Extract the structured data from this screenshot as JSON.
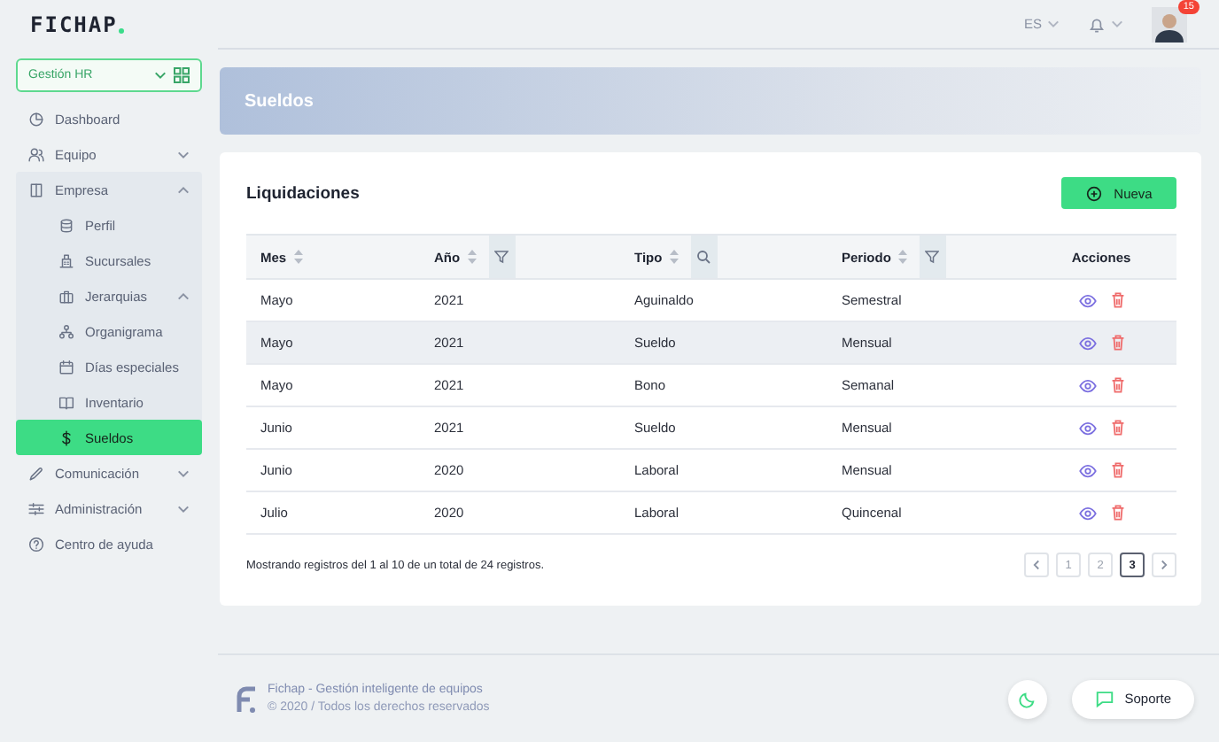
{
  "brand": {
    "logo": "FICHAP"
  },
  "sidebar": {
    "workspace": "Gestión HR",
    "items": [
      {
        "label": "Dashboard",
        "selected": false
      },
      {
        "label": "Equipo",
        "expanded": false,
        "selected": false
      },
      {
        "label": "Empresa",
        "expanded": true,
        "selected": false,
        "children": [
          {
            "label": "Perfil",
            "selected": false
          },
          {
            "label": "Sucursales",
            "selected": false
          },
          {
            "label": "Jerarquias",
            "expanded": true,
            "selected": false
          },
          {
            "label": "Organigrama",
            "selected": false
          },
          {
            "label": "Días especiales",
            "selected": false
          },
          {
            "label": "Inventario",
            "selected": false
          },
          {
            "label": "Sueldos",
            "selected": true
          }
        ]
      },
      {
        "label": "Comunicación",
        "expanded": false,
        "selected": false
      },
      {
        "label": "Administración",
        "expanded": false,
        "selected": false
      },
      {
        "label": "Centro de ayuda",
        "selected": false
      }
    ]
  },
  "header": {
    "language": "ES",
    "notifications_badge": "15"
  },
  "banner": {
    "title": "Sueldos"
  },
  "card": {
    "title": "Liquidaciones",
    "new_button": "Nueva",
    "table": {
      "columns": [
        {
          "label": "Mes",
          "sortable": true,
          "kind": "plain"
        },
        {
          "label": "Año",
          "sortable": true,
          "kind": "filter"
        },
        {
          "label": "Tipo",
          "sortable": true,
          "kind": "search"
        },
        {
          "label": "Periodo",
          "sortable": true,
          "kind": "filter"
        },
        {
          "label": "Acciones",
          "sortable": false,
          "kind": "plain"
        }
      ],
      "rows": [
        {
          "cells": [
            "Mayo",
            "2021",
            "Aguinaldo",
            "Semestral"
          ],
          "hovered": false
        },
        {
          "cells": [
            "Mayo",
            "2021",
            "Sueldo",
            "Mensual"
          ],
          "hovered": true
        },
        {
          "cells": [
            "Mayo",
            "2021",
            "Bono",
            "Semanal"
          ],
          "hovered": false
        },
        {
          "cells": [
            "Junio",
            "2021",
            "Sueldo",
            "Mensual"
          ],
          "hovered": false
        },
        {
          "cells": [
            "Junio",
            "2020",
            "Laboral",
            "Mensual"
          ],
          "hovered": false
        },
        {
          "cells": [
            "Julio",
            "2020",
            "Laboral",
            "Quincenal"
          ],
          "hovered": false
        }
      ]
    },
    "summary": "Mostrando registros del 1 al 10 de un total de 24 registros.",
    "pages": [
      {
        "label": "1",
        "selected": false
      },
      {
        "label": "2",
        "selected": false
      },
      {
        "label": "3",
        "selected": true
      }
    ]
  },
  "footer": {
    "title": "Fichap - Gestión inteligente de equipos",
    "copyright": "© 2020 / Todos los derechos reservados",
    "support_button": "Soporte"
  }
}
